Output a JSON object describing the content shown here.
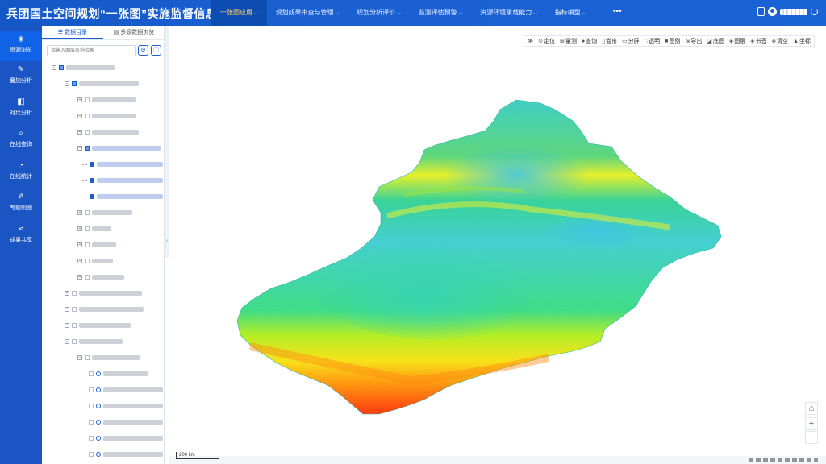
{
  "header": {
    "title": "兵团国土空间规划“一张图”实施监督信息系统",
    "nav": [
      {
        "label": "一张图应用",
        "active": true
      },
      {
        "label": "规划成果审查与管理",
        "active": false
      },
      {
        "label": "规划分析评价",
        "active": false
      },
      {
        "label": "监测评估预警",
        "active": false
      },
      {
        "label": "资源环境承载能力",
        "active": false
      },
      {
        "label": "指标模型",
        "active": false
      }
    ],
    "more_label": "•••"
  },
  "sidebar": {
    "items": [
      {
        "label": "资源浏览",
        "icon": "layers-icon",
        "active": true
      },
      {
        "label": "叠加分析",
        "icon": "edit-icon",
        "active": false
      },
      {
        "label": "对比分析",
        "icon": "compare-icon",
        "active": false
      },
      {
        "label": "在线查询",
        "icon": "search-icon",
        "active": false
      },
      {
        "label": "在线统计",
        "icon": "pie-chart-icon",
        "active": false
      },
      {
        "label": "专题制图",
        "icon": "draw-icon",
        "active": false
      },
      {
        "label": "成果共享",
        "icon": "share-icon",
        "active": false
      }
    ]
  },
  "catalog": {
    "tabs": [
      {
        "label": "数据目录",
        "icon": "list-icon",
        "active": true
      },
      {
        "label": "多源数据浏览",
        "icon": "file-icon",
        "active": false
      }
    ],
    "search_placeholder": "请输入图层名称检索"
  },
  "map": {
    "tools": [
      {
        "label": "定位",
        "icon": "locate-icon"
      },
      {
        "label": "量测",
        "icon": "measure-icon"
      },
      {
        "label": "查询",
        "icon": "info-icon"
      },
      {
        "label": "卷帘",
        "icon": "swipe-icon"
      },
      {
        "label": "分屏",
        "icon": "split-screen-icon"
      },
      {
        "label": "透明",
        "icon": "transparency-icon"
      },
      {
        "label": "图例",
        "icon": "legend-icon"
      },
      {
        "label": "导出",
        "icon": "export-icon"
      },
      {
        "label": "底图",
        "icon": "basemap-icon"
      },
      {
        "label": "图层",
        "icon": "layers-icon"
      },
      {
        "label": "书签",
        "icon": "bookmark-icon"
      },
      {
        "label": "清空",
        "icon": "clear-icon"
      },
      {
        "label": "坐标",
        "icon": "coordinates-icon"
      }
    ],
    "scale_label": "200 km",
    "zoom_in": "+",
    "zoom_out": "−",
    "colors": {
      "low": "#ff3300",
      "mid": "#aaee22",
      "high": "#22ccaa",
      "flat": "#44ccdd"
    }
  }
}
